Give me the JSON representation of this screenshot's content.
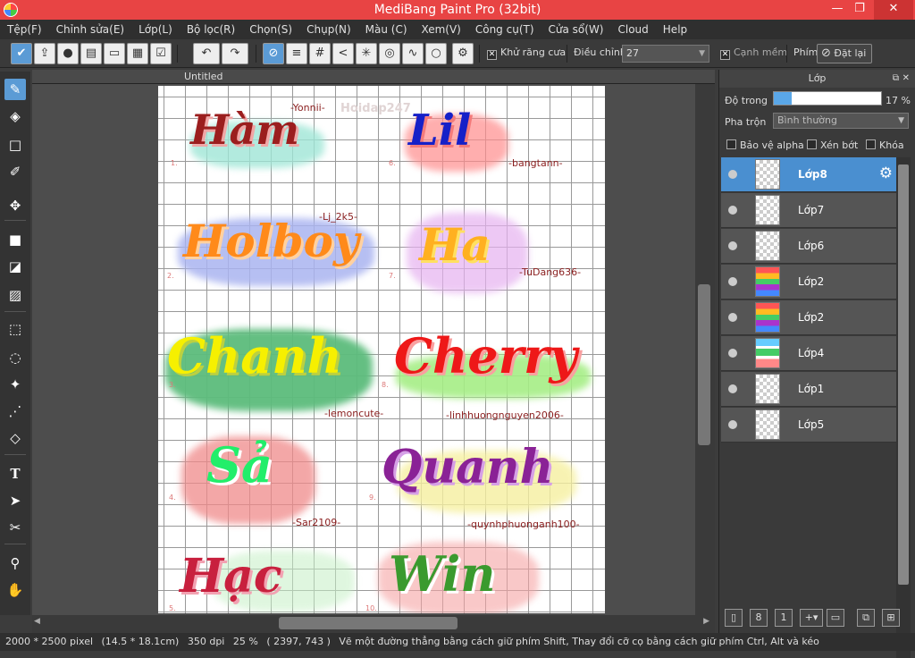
{
  "window": {
    "title": "MediBang Paint Pro (32bit)",
    "minimize": "—",
    "restore": "❐",
    "close": "✕"
  },
  "menu": [
    "Tệp(F)",
    "Chỉnh sửa(E)",
    "Lớp(L)",
    "Bộ lọc(R)",
    "Chọn(S)",
    "Chụp(N)",
    "Màu (C)",
    "Xem(V)",
    "Công cụ(T)",
    "Cửa sổ(W)",
    "Cloud",
    "Help"
  ],
  "toolbar": {
    "antialias_label": "Khử răng cưa",
    "antialias_checked": "✕",
    "adjust_label": "Điều chỉnh",
    "adjust_value": "27",
    "soft_edge_label": "Cạnh mềm",
    "soft_edge_checked": "✕",
    "key_label": "Phím",
    "reset_label": "Đặt lại"
  },
  "document": {
    "tab": "Untitled"
  },
  "artwork": {
    "watermark": "Hoidap247",
    "words": [
      {
        "text": "Hàm",
        "tag": "-Yonnii-",
        "num": "1."
      },
      {
        "text": "Lil",
        "tag": "-bangtann-",
        "num": "6."
      },
      {
        "text": "Holboy",
        "tag": "-Lj_2k5-",
        "num": "2."
      },
      {
        "text": "Ha",
        "tag": "-TuDang636-",
        "num": "7."
      },
      {
        "text": "Chanh",
        "tag": "-lemoncute-",
        "num": "3."
      },
      {
        "text": "Cherry",
        "tag": "-linhhuongnguyen2006-",
        "num": "8."
      },
      {
        "text": "Sả",
        "tag": "-Sar2109-",
        "num": "4."
      },
      {
        "text": "Quanh",
        "tag": "-quynhphuonganh100-",
        "num": "9."
      },
      {
        "text": "Hạc",
        "tag": "",
        "num": "5."
      },
      {
        "text": "Win",
        "tag": "",
        "num": "10."
      }
    ]
  },
  "layers_panel": {
    "title": "Lớp",
    "opacity_label": "Độ trong",
    "opacity_value": "17 %",
    "opacity_percent": 17,
    "blend_label": "Pha trộn",
    "blend_value": "Bình thường",
    "protect_alpha": "Bảo vệ alpha",
    "clipping": "Xén bớt",
    "lock": "Khóa",
    "layers": [
      "Lớp8",
      "Lớp7",
      "Lớp6",
      "Lớp2",
      "Lớp2",
      "Lớp4",
      "Lớp1",
      "Lớp5"
    ]
  },
  "status": {
    "size": "2000 * 2500 pixel",
    "physical": "(14.5 * 18.1cm)",
    "dpi": "350 dpi",
    "zoom": "25 %",
    "coords": "( 2397, 743 )",
    "hint": "Vẽ một đường thẳng bằng cách giữ phím Shift, Thay đổi cỡ cọ bằng cách giữ phím Ctrl, Alt và kéo"
  },
  "colors": {
    "titlebar": "#e84444",
    "accent": "#5b9bd5",
    "active_layer": "#4a8fd0"
  }
}
